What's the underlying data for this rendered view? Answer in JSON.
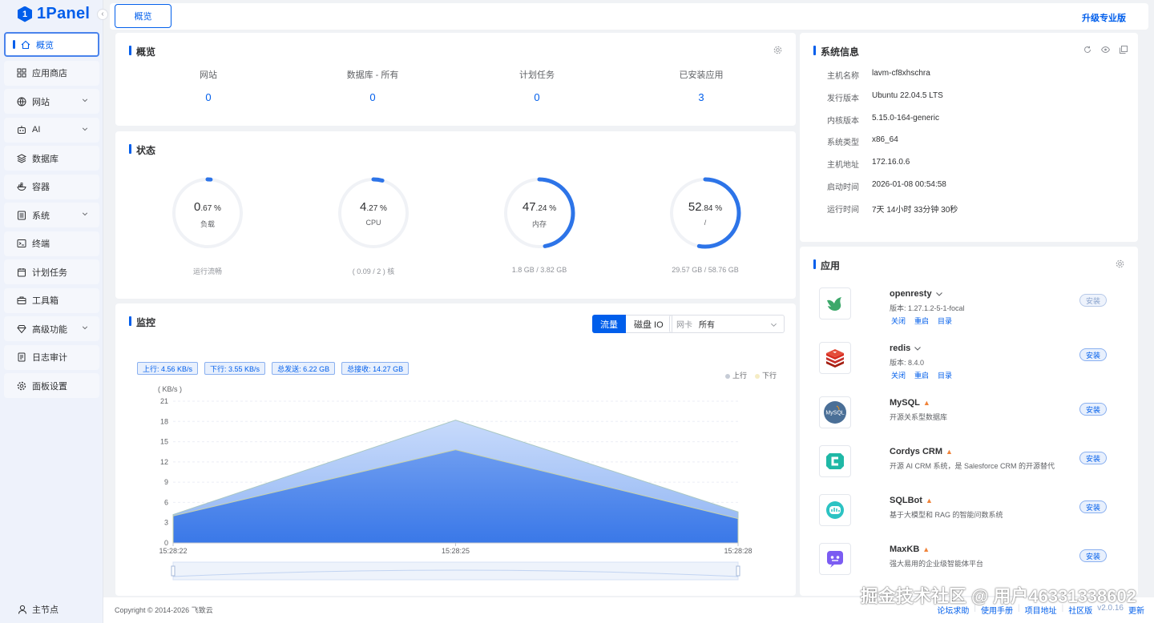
{
  "app": {
    "logo_text": "1Panel",
    "logo_mark": "1",
    "brand_color": "#005eeb"
  },
  "sidebar": {
    "items": [
      {
        "label": "概览",
        "icon": "home-icon",
        "active": true
      },
      {
        "label": "应用商店",
        "icon": "grid-icon"
      },
      {
        "label": "网站",
        "icon": "globe-icon",
        "expandable": true
      },
      {
        "label": "AI",
        "icon": "robot-icon",
        "expandable": true
      },
      {
        "label": "数据库",
        "icon": "layers-icon"
      },
      {
        "label": "容器",
        "icon": "container-icon"
      },
      {
        "label": "系统",
        "icon": "system-icon",
        "expandable": true
      },
      {
        "label": "终端",
        "icon": "terminal-icon"
      },
      {
        "label": "计划任务",
        "icon": "calendar-icon"
      },
      {
        "label": "工具箱",
        "icon": "toolbox-icon"
      },
      {
        "label": "高级功能",
        "icon": "diamond-icon",
        "expandable": true
      },
      {
        "label": "日志审计",
        "icon": "log-icon"
      },
      {
        "label": "面板设置",
        "icon": "gear-icon"
      }
    ],
    "node_label": "主节点"
  },
  "topbar": {
    "tab": "概览",
    "upgrade": "升级专业版"
  },
  "overview": {
    "title": "概览",
    "items": [
      {
        "label": "网站",
        "value": "0"
      },
      {
        "label": "数据库 - 所有",
        "value": "0"
      },
      {
        "label": "计划任务",
        "value": "0"
      },
      {
        "label": "已安装应用",
        "value": "3"
      }
    ]
  },
  "status": {
    "title": "状态",
    "gauges": [
      {
        "int": "0",
        "dec": ".67",
        "unit": " %",
        "label": "负载",
        "sub": "运行流畅",
        "percent": 0.67
      },
      {
        "int": "4",
        "dec": ".27",
        "unit": " %",
        "label": "CPU",
        "sub": "( 0.09 / 2 ) 核",
        "percent": 4.27
      },
      {
        "int": "47",
        "dec": ".24",
        "unit": " %",
        "label": "内存",
        "sub": "1.8 GB / 3.82 GB",
        "percent": 47.24
      },
      {
        "int": "52",
        "dec": ".84",
        "unit": " %",
        "label": "/",
        "sub": "29.57 GB / 58.76 GB",
        "percent": 52.84
      }
    ]
  },
  "monitor": {
    "title": "监控",
    "seg_traffic": "流量",
    "seg_disk": "磁盘 IO",
    "nic_label": "网卡",
    "nic_value": "所有",
    "tags": [
      "上行: 4.56 KB/s",
      "下行: 3.55 KB/s",
      "总发送: 6.22 GB",
      "总接收: 14.27 GB"
    ]
  },
  "chart_data": {
    "type": "area",
    "ylabel": "( KB/s )",
    "ylim": [
      0,
      21
    ],
    "yticks": [
      "0",
      "3",
      "6",
      "9",
      "12",
      "15",
      "18",
      "21"
    ],
    "x": [
      "15:28:22",
      "15:28:25",
      "15:28:28"
    ],
    "series": [
      {
        "name": "上行",
        "values": [
          4.2,
          18.2,
          4.6
        ],
        "color": "#9fc0f5"
      },
      {
        "name": "下行",
        "values": [
          4.0,
          13.8,
          3.6
        ],
        "color": "#4a84ea"
      }
    ],
    "legend_position": "top-right",
    "grid": true
  },
  "sysinfo": {
    "title": "系统信息",
    "rows": [
      {
        "k": "主机名称",
        "v": "lavm-cf8xhschra"
      },
      {
        "k": "发行版本",
        "v": "Ubuntu 22.04.5 LTS"
      },
      {
        "k": "内核版本",
        "v": "5.15.0-164-generic"
      },
      {
        "k": "系统类型",
        "v": "x86_64"
      },
      {
        "k": "主机地址",
        "v": "172.16.0.6"
      },
      {
        "k": "启动时间",
        "v": "2026-01-08 00:54:58"
      },
      {
        "k": "运行时间",
        "v": "7天 14小时 33分钟 30秒"
      }
    ]
  },
  "apps": {
    "title": "应用",
    "items": [
      {
        "name": "openresty",
        "desc": "版本: 1.27.1.2-5-1-focal",
        "button": "安装",
        "installed": true,
        "links": [
          "关闭",
          "重启",
          "目录"
        ]
      },
      {
        "name": "redis",
        "desc": "版本: 8.4.0",
        "button": "安装",
        "installed": false,
        "links": [
          "关闭",
          "重启",
          "目录"
        ]
      },
      {
        "name": "MySQL",
        "desc": "开源关系型数据库",
        "button": "安装",
        "installed": false,
        "hot": true
      },
      {
        "name": "Cordys CRM",
        "desc": "开源 AI CRM 系统，是 Salesforce CRM 的开源替代",
        "button": "安装",
        "installed": false,
        "hot": true
      },
      {
        "name": "SQLBot",
        "desc": "基于大模型和 RAG 的智能问数系统",
        "button": "安装",
        "installed": false,
        "hot": true
      },
      {
        "name": "MaxKB",
        "desc": "强大易用的企业级智能体平台",
        "button": "安装",
        "installed": false,
        "hot": true
      }
    ]
  },
  "footer": {
    "copyright": "Copyright © 2014-2026 飞致云",
    "links": [
      "论坛求助",
      "使用手册",
      "项目地址",
      "社区版"
    ],
    "version": "v2.0.16",
    "update": "更新"
  },
  "watermark": "掘金技术社区 @ 用户46331338602"
}
